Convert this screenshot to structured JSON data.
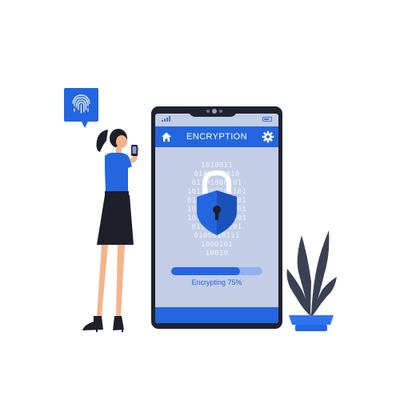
{
  "app": {
    "header_title": "ENCRYPTION",
    "home_icon": "home-icon",
    "settings_icon": "gear-icon",
    "lock_icon": "padlock-shield-icon"
  },
  "encryption": {
    "progress_percent": 75,
    "progress_label": "Encrypting 75%",
    "binary_lines": [
      "1010011",
      "0101100010",
      "01101000101",
      "1011100101101",
      "0101011010101",
      "1011010110101",
      "1011010010101",
      "01101000101",
      "0100010111",
      "1000101",
      "10010"
    ]
  },
  "illustration": {
    "fingerprint_icon": "fingerprint-icon",
    "plant": "potted-plant",
    "person": "woman-holding-phone"
  },
  "colors": {
    "accent": "#2466e0",
    "screen_bg": "#c3cde6",
    "phone_body": "#1f2230",
    "progress_track": "#91b2f2",
    "pot": "#2f74ef",
    "leaf": "#3a4152"
  }
}
